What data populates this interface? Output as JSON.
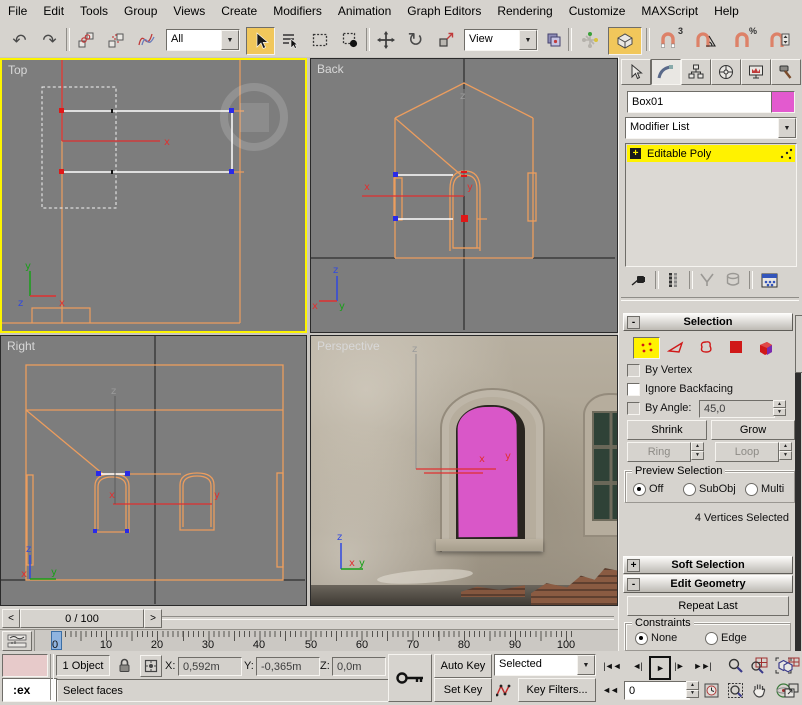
{
  "menubar": {
    "items": [
      "File",
      "Edit",
      "Tools",
      "Group",
      "Views",
      "Create",
      "Modifiers",
      "Animation",
      "Graph Editors",
      "Rendering",
      "Customize",
      "MAXScript",
      "Help"
    ]
  },
  "toolbar": {
    "selection_filter": "All",
    "coordinate_system": "View",
    "snap3_sup": "3",
    "snap_percent_sup": "%"
  },
  "icons": {
    "undo": "↶",
    "redo": "↷",
    "dropdown_arrow": "▼",
    "rotate": "↻",
    "spinner_up": "▲",
    "spinner_down": "▼",
    "goto_start": "|◄◄",
    "prev_frame": "◄|",
    "play": "►",
    "next_frame": "|►",
    "goto_end": "►►|",
    "key_mode": "◄◄",
    "plus": "+",
    "minus": "-"
  },
  "viewports": {
    "top": {
      "label": "Top"
    },
    "back": {
      "label": "Back"
    },
    "right": {
      "label": "Right"
    },
    "perspective": {
      "label": "Perspective"
    },
    "axis": {
      "x": "x",
      "y": "y",
      "z": "z"
    }
  },
  "command_panel": {
    "object_name": "Box01",
    "modifier_list": "Modifier List",
    "stack_item": "Editable Poly",
    "selection": {
      "title": "Selection",
      "by_vertex": "By Vertex",
      "ignore_backfacing": "Ignore Backfacing",
      "by_angle": "By Angle:",
      "angle_value": "45,0",
      "shrink": "Shrink",
      "grow": "Grow",
      "ring": "Ring",
      "loop": "Loop",
      "preview": "Preview Selection",
      "off": "Off",
      "subobj": "SubObj",
      "multi": "Multi",
      "status": "4 Vertices Selected"
    },
    "soft_selection": "Soft Selection",
    "edit_geometry": "Edit Geometry",
    "repeat_last": "Repeat Last",
    "constraints": {
      "title": "Constraints",
      "none": "None",
      "edge": "Edge"
    }
  },
  "timeline": {
    "slider": "0 / 100",
    "prev_arrow": "<",
    "next_arrow": ">",
    "tick_labels": [
      "0",
      "10",
      "20",
      "30",
      "40",
      "50",
      "60",
      "70",
      "80",
      "90",
      "100"
    ]
  },
  "status_bar": {
    "listener_text": ":ex",
    "object_count": "1 Object",
    "x_label": "X:",
    "y_label": "Y:",
    "z_label": "Z:",
    "x_value": "0,592m",
    "y_value": "-0,365m",
    "z_value": "0,0m",
    "prompt": "Select faces",
    "auto_key": "Auto Key",
    "set_key": "Set Key",
    "selected_filter": "Selected",
    "key_filters": "Key Filters...",
    "frame": "0"
  },
  "colors": {
    "viewport_bg": "#7D7D7D",
    "wireframe_orange": "#EC9D5E",
    "stack_yellow": "#FFF200",
    "active_viewport_border": "#FCF400",
    "object_color": "#E35ACF",
    "toolbar_highlight": "#F1C75B",
    "ui_gray": "#D6D3CE"
  }
}
